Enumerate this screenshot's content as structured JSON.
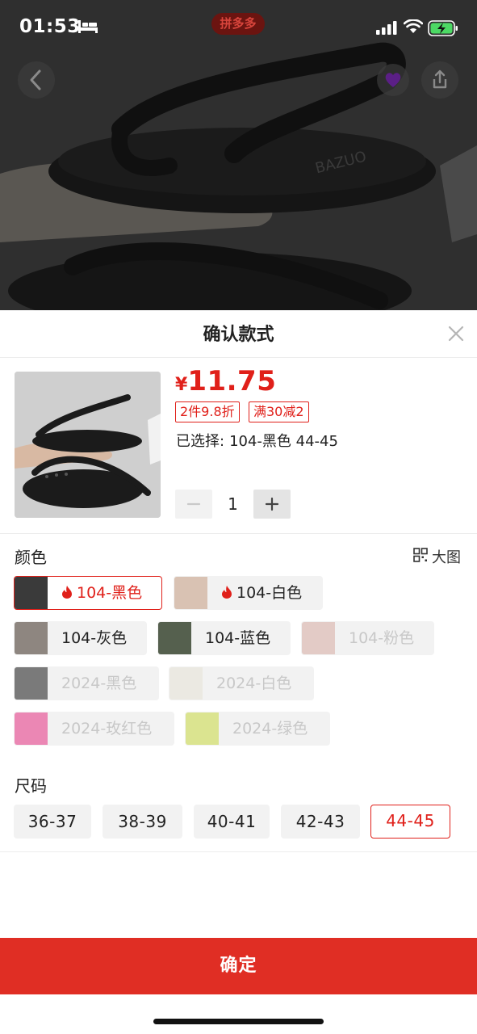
{
  "status_bar": {
    "time": "01:53",
    "badge": "拼多多"
  },
  "sheet": {
    "title": "确认款式",
    "price": {
      "currency": "¥",
      "amount": "11.75"
    },
    "promos": [
      "2件9.8折",
      "满30减2"
    ],
    "selected": {
      "label": "已选择:",
      "value": "104-黑色 44-45"
    },
    "quantity": {
      "value": "1"
    },
    "color_section": {
      "label": "颜色",
      "big_image_label": "大图",
      "options": [
        {
          "label": "104-黑色",
          "state": "selected",
          "hot": true
        },
        {
          "label": "104-白色",
          "state": "available",
          "hot": true
        },
        {
          "label": "104-灰色",
          "state": "available",
          "hot": false
        },
        {
          "label": "104-蓝色",
          "state": "available",
          "hot": false
        },
        {
          "label": "104-粉色",
          "state": "disabled",
          "hot": false
        },
        {
          "label": "2024-黑色",
          "state": "disabled",
          "hot": false
        },
        {
          "label": "2024-白色",
          "state": "disabled",
          "hot": false
        },
        {
          "label": "2024-玫红色",
          "state": "disabled",
          "hot": false
        },
        {
          "label": "2024-绿色",
          "state": "disabled",
          "hot": false
        }
      ]
    },
    "size_section": {
      "label": "尺码",
      "options": [
        {
          "label": "36-37",
          "state": "available"
        },
        {
          "label": "38-39",
          "state": "available"
        },
        {
          "label": "40-41",
          "state": "available"
        },
        {
          "label": "42-43",
          "state": "available"
        },
        {
          "label": "44-45",
          "state": "selected"
        }
      ]
    },
    "confirm_label": "确定"
  },
  "product_image": {
    "logo_text": "BAZUO"
  },
  "colors": {
    "accent": "#e0201a",
    "confirm_bg": "#e02e24",
    "chip_bg": "#f2f2f2",
    "disabled_text": "#c8c8c8"
  },
  "icons": [
    "back-icon",
    "share-icon",
    "close-icon",
    "grid-icon",
    "fire-icon",
    "minus-icon",
    "plus-icon",
    "bed-icon",
    "signal-icon",
    "wifi-icon",
    "battery-icon"
  ]
}
